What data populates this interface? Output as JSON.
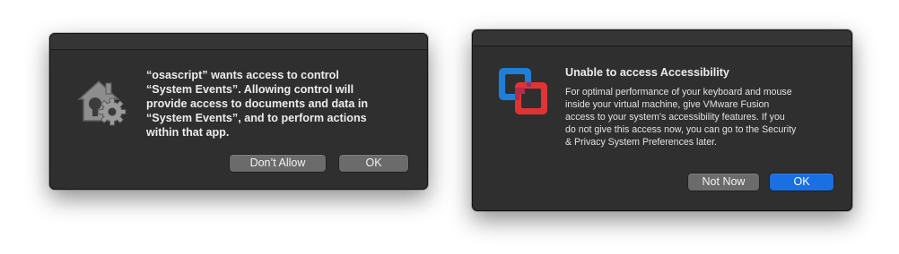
{
  "dialog_osascript": {
    "message": "“osascript” wants access to control\n“System Events”. Allowing control will\nprovide access to documents and data in\n“System Events”, and to perform actions\nwithin that app.",
    "deny_label": "Don’t Allow",
    "ok_label": "OK",
    "icon": "security-preferences-gear-icon"
  },
  "dialog_vmware": {
    "title": "Unable to access Accessibility",
    "message": "For optimal performance of your keyboard and mouse\ninside your virtual machine, give VMware Fusion\naccess to your system’s accessibility features. If you\ndo not give this access now, you can go to the Security\n& Privacy System Preferences later.",
    "not_now_label": "Not Now",
    "ok_label": "OK",
    "icon": "vmware-fusion-icon"
  },
  "colors": {
    "dialog_bg": "#2f2f2f",
    "button_bg": "#6b6b6b",
    "primary_button": "#1a6fe2",
    "vmware_blue": "#1f7ed6",
    "vmware_red": "#e03434"
  }
}
